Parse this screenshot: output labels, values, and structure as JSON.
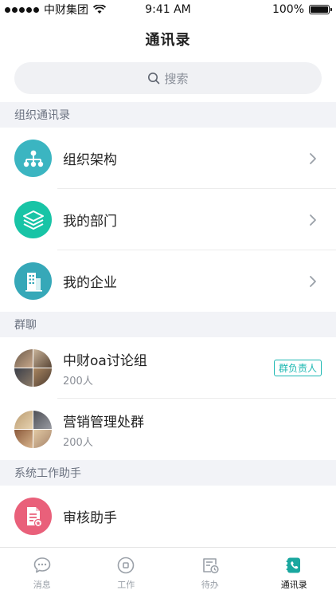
{
  "status_bar": {
    "carrier": "中财集团",
    "time": "9:41 AM",
    "battery": "100%",
    "battery_level": 1.0
  },
  "nav": {
    "title": "通讯录"
  },
  "search": {
    "placeholder": "搜索"
  },
  "sections": {
    "org": {
      "header": "组织通讯录",
      "items": [
        {
          "label": "组织架构",
          "icon": "org-chart-icon",
          "color": "#3bb5c1"
        },
        {
          "label": "我的部门",
          "icon": "layers-icon",
          "color": "#18c4a6"
        },
        {
          "label": "我的企业",
          "icon": "building-icon",
          "color": "#36a8b8"
        }
      ]
    },
    "groups": {
      "header": "群聊",
      "items": [
        {
          "label": "中财oa讨论组",
          "count": "200人",
          "tag": "群负责人"
        },
        {
          "label": "营销管理处群",
          "count": "200人"
        }
      ]
    },
    "assistants": {
      "header": "系统工作助手",
      "items": [
        {
          "label": "审核助手",
          "icon": "document-icon",
          "color": "#e9607a"
        }
      ]
    }
  },
  "tab_bar": {
    "tabs": [
      {
        "label": "消息",
        "icon": "chat-bubble-icon",
        "active": false
      },
      {
        "label": "工作",
        "icon": "work-circle-icon",
        "active": false
      },
      {
        "label": "待办",
        "icon": "todo-clock-icon",
        "active": false
      },
      {
        "label": "通讯录",
        "icon": "contacts-book-icon",
        "active": true
      }
    ]
  },
  "colors": {
    "accent": "#1cb8b2",
    "section_bg": "#f2f3f7",
    "search_bg": "#f0f1f4"
  }
}
